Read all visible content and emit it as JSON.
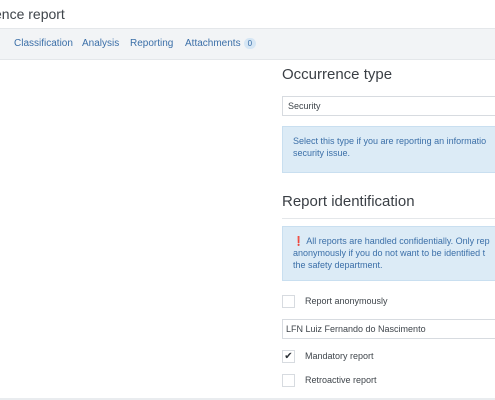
{
  "header": {
    "title": "ence report"
  },
  "tabs": [
    {
      "label": "Classification"
    },
    {
      "label": "Analysis"
    },
    {
      "label": "Reporting"
    },
    {
      "label": "Attachments",
      "count": "0"
    }
  ],
  "occurrence_type": {
    "heading": "Occurrence type",
    "selected_value": "Security",
    "help_line1": "Select this type if you are reporting an informatio",
    "help_line2": "security issue."
  },
  "report_identification": {
    "heading": "Report identification",
    "info_icon": "exclamation-circle-icon",
    "info_line1": "All reports are handled confidentially. Only rep",
    "info_line2": "anonymously if you do not want to be identified t",
    "info_line3": "the safety department.",
    "anonymous": {
      "label": "Report anonymously",
      "checked": false
    },
    "reporter_value": "LFN Luiz Fernando do Nascimento",
    "mandatory": {
      "label": "Mandatory report",
      "checked": true,
      "mark": "✔"
    },
    "retroactive": {
      "label": "Retroactive report",
      "checked": false
    }
  },
  "colors": {
    "link": "#3b6fa8",
    "info_background": "#dcebf6"
  }
}
